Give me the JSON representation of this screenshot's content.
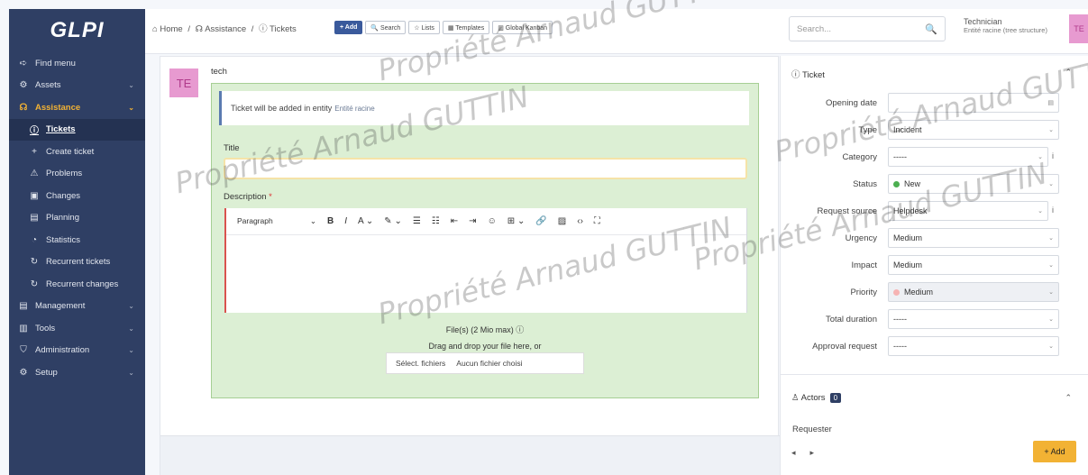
{
  "sidebar": {
    "logo": "GLPI",
    "items": [
      {
        "label": "Find menu",
        "icon": "➪",
        "chevron": ""
      },
      {
        "label": "Assets",
        "icon": "⚙",
        "chevron": "⌄"
      },
      {
        "label": "Assistance",
        "icon": "☊",
        "chevron": "⌄"
      },
      {
        "label": "Tickets",
        "icon": "ⓘ",
        "chevron": ""
      },
      {
        "label": "Create ticket",
        "icon": "+",
        "chevron": ""
      },
      {
        "label": "Problems",
        "icon": "⚠",
        "chevron": ""
      },
      {
        "label": "Changes",
        "icon": "▣",
        "chevron": ""
      },
      {
        "label": "Planning",
        "icon": "▤",
        "chevron": ""
      },
      {
        "label": "Statistics",
        "icon": "◔",
        "chevron": ""
      },
      {
        "label": "Recurrent tickets",
        "icon": "↻",
        "chevron": ""
      },
      {
        "label": "Recurrent changes",
        "icon": "↻",
        "chevron": ""
      },
      {
        "label": "Management",
        "icon": "▤",
        "chevron": "⌄"
      },
      {
        "label": "Tools",
        "icon": "▥",
        "chevron": "⌄"
      },
      {
        "label": "Administration",
        "icon": "⛉",
        "chevron": "⌄"
      },
      {
        "label": "Setup",
        "icon": "⚙",
        "chevron": "⌄"
      }
    ]
  },
  "header": {
    "crumb_home": "⌂ Home",
    "crumb_sep": "/",
    "crumb_assistance": "☊ Assistance",
    "crumb_tickets": "ⓘ Tickets",
    "btn_add": "+ Add",
    "btn_search": "🔍 Search",
    "btn_lists": "☆ Lists",
    "btn_templates": "▦ Templates",
    "btn_kanban": "▥ Global Kanban",
    "search_placeholder": "Search...",
    "search_icon": "🔍",
    "user_role": "Technician",
    "user_entity": "Entité racine (tree structure)",
    "avatar": "TE"
  },
  "ticket_form": {
    "avatar": "TE",
    "author": "tech",
    "alert_text": "Ticket will be added in entity",
    "alert_entity": "Entité racine",
    "title_label": "Title",
    "desc_label": "Description",
    "required_mark": "*",
    "toolbar": {
      "paragraph": "Paragraph",
      "para_caret": "⌄",
      "bold": "B",
      "italic": "I",
      "text_color": "A ⌄",
      "highlight": "✎ ⌄",
      "bullet_list": "☰",
      "num_list": "☷",
      "outdent": "⇤",
      "indent": "⇥",
      "emoji": "☺",
      "table": "⊞ ⌄",
      "link": "🔗",
      "image": "▨",
      "code": "‹›",
      "fullscreen": "⛶"
    },
    "files_label": "File(s) (2 Mio max) ⓘ",
    "drag_text": "Drag and drop your file here, or",
    "select_files": "Sélect. fichiers",
    "no_file": "Aucun fichier choisi"
  },
  "ticket_panel": {
    "header": "ⓘ Ticket",
    "collapse": "⌃",
    "fields": [
      {
        "label": "Opening date",
        "value": "",
        "caret": "▤",
        "info": "",
        "dot": ""
      },
      {
        "label": "Type",
        "value": "Incident",
        "caret": "⌄",
        "info": "",
        "dot": ""
      },
      {
        "label": "Category",
        "value": "-----",
        "caret": "⌄",
        "info": "i",
        "dot": ""
      },
      {
        "label": "Status",
        "value": "New",
        "caret": "⌄",
        "info": "",
        "dot": "#4caf50"
      },
      {
        "label": "Request source",
        "value": "Helpdesk",
        "caret": "⌄",
        "info": "i",
        "dot": ""
      },
      {
        "label": "Urgency",
        "value": "Medium",
        "caret": "⌄",
        "info": "",
        "dot": ""
      },
      {
        "label": "Impact",
        "value": "Medium",
        "caret": "⌄",
        "info": "",
        "dot": ""
      },
      {
        "label": "Priority",
        "value": "Medium",
        "caret": "⌄",
        "info": "",
        "dot": "#f6b3b3"
      },
      {
        "label": "Total duration",
        "value": "-----",
        "caret": "⌄",
        "info": "",
        "dot": ""
      },
      {
        "label": "Approval request",
        "value": "-----",
        "caret": "⌄",
        "info": "",
        "dot": ""
      }
    ],
    "actors_label": "♙ Actors",
    "actors_count": "0",
    "requester_label": "Requester",
    "pager_prev": "◂",
    "pager_next": "▸",
    "add_button": "+ Add"
  },
  "watermark": "Propriété Arnaud GUTTIN"
}
